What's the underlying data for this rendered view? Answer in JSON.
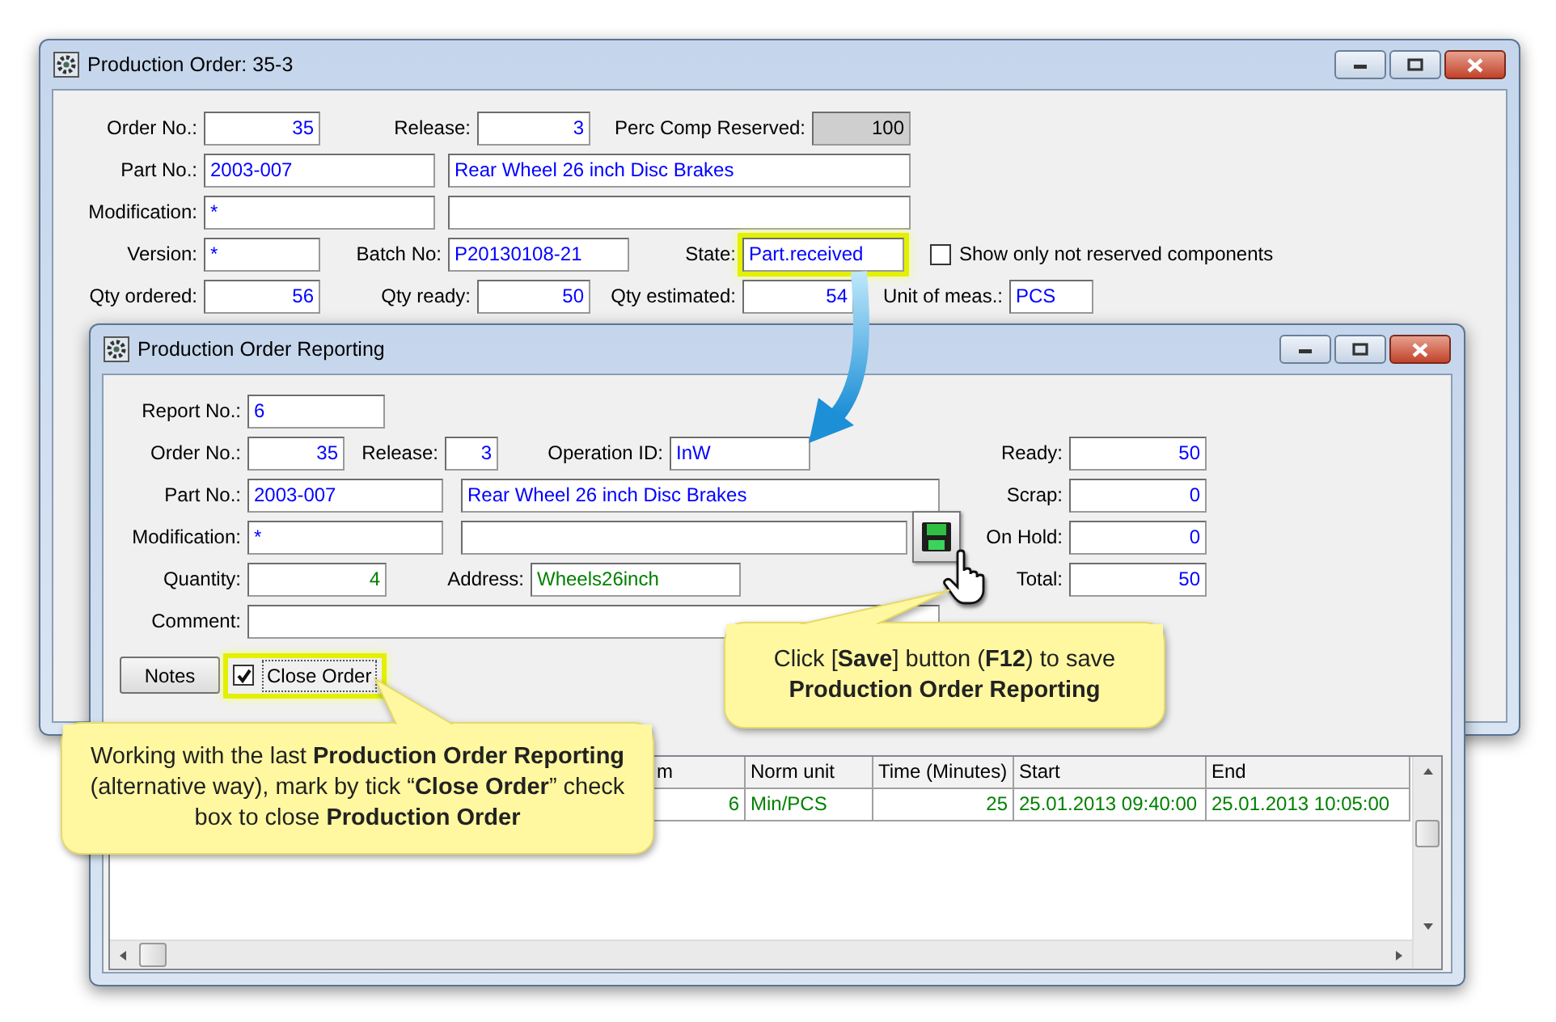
{
  "main_window": {
    "title": "Production Order: 35-3",
    "rows": [
      [
        {
          "label": "Order No.:",
          "value": "35",
          "kind": "number",
          "color": "#0000ff",
          "shaded": false,
          "highlighted": false
        },
        {
          "label": "Release:",
          "value": "3",
          "kind": "number",
          "color": "#0000ff",
          "shaded": false,
          "highlighted": false
        },
        {
          "label": "Perc Comp Reserved:",
          "value": "100",
          "kind": "number",
          "color": "#000000",
          "shaded": true,
          "highlighted": false
        }
      ],
      [
        {
          "label": "Part No.:",
          "value": "2003-007",
          "kind": "text",
          "color": "#0000ff",
          "shaded": false,
          "highlighted": false
        },
        {
          "value": "Rear Wheel 26 inch Disc Brakes",
          "kind": "text",
          "color": "#0000ff",
          "shaded": false,
          "highlighted": false
        }
      ],
      [
        {
          "label": "Modification:",
          "value": "*",
          "kind": "text",
          "color": "#0000ff",
          "shaded": false,
          "highlighted": false
        },
        {
          "kind": "text",
          "shaded": false,
          "highlighted": false
        }
      ],
      [
        {
          "label": "Version:",
          "value": "*",
          "kind": "text",
          "color": "#0000ff",
          "shaded": false,
          "highlighted": false
        },
        {
          "label": "Batch No:",
          "value": "P20130108-21",
          "kind": "text",
          "color": "#0000ff",
          "shaded": false,
          "highlighted": false
        },
        {
          "label": "State:",
          "value": "Part.received",
          "kind": "text",
          "color": "#0000ff",
          "shaded": false,
          "highlighted": true
        }
      ],
      [
        {
          "label": "Qty ordered:",
          "value": "56",
          "kind": "number",
          "color": "#0000ff",
          "shaded": false,
          "highlighted": false
        },
        {
          "label": "Qty ready:",
          "value": "50",
          "kind": "number",
          "color": "#0000ff",
          "shaded": false,
          "highlighted": false
        },
        {
          "label": "Qty estimated:",
          "value": "54",
          "kind": "number",
          "color": "#0000ff",
          "shaded": false,
          "highlighted": false
        },
        {
          "label": "Unit of meas.:",
          "value": "PCS",
          "kind": "text",
          "color": "#0000ff",
          "shaded": false,
          "highlighted": false
        }
      ]
    ],
    "checkbox": {
      "label": "Show only not reserved components",
      "checked": false
    }
  },
  "reporting_window": {
    "title": "Production Order Reporting",
    "rows": [
      [
        {
          "label": "Report No.:",
          "value": "6",
          "kind": "text",
          "color": "#0000ff"
        }
      ],
      [
        {
          "label": "Order No.:",
          "value": "35",
          "kind": "number",
          "color": "#0000ff"
        },
        {
          "label": "Release:",
          "value": "3",
          "kind": "number",
          "color": "#0000ff"
        },
        {
          "label": "Operation ID:",
          "value": "InW",
          "kind": "text",
          "color": "#0000ff"
        }
      ],
      [
        {
          "label": "Part No.:",
          "value": "2003-007",
          "kind": "text",
          "color": "#0000ff"
        },
        {
          "value": "Rear Wheel 26 inch Disc Brakes",
          "kind": "text",
          "color": "#0000ff"
        }
      ],
      [
        {
          "label": "Modification:",
          "value": "*",
          "kind": "text",
          "color": "#0000ff"
        },
        {
          "kind": "text"
        }
      ],
      [
        {
          "label": "Quantity:",
          "value": "4",
          "kind": "number",
          "color": "#008000"
        },
        {
          "label": "Address:",
          "value": "Wheels26inch",
          "kind": "text",
          "color": "#008000"
        }
      ],
      [
        {
          "label": "Comment:",
          "kind": "text"
        }
      ]
    ],
    "totals": [
      {
        "label": "Ready:",
        "value": "50"
      },
      {
        "label": "Scrap:",
        "value": "0"
      },
      {
        "label": "On Hold:",
        "value": "0"
      },
      {
        "label": "Total:",
        "value": "50"
      }
    ],
    "notes_button": "Notes",
    "close_order": {
      "label": "Close Order",
      "checked": true,
      "highlighted": true
    },
    "grid": {
      "columns": [
        "m",
        "Norm unit",
        "Time (Minutes)",
        "Start",
        "End"
      ],
      "rows": [
        {
          "cells": [
            "6",
            "Min/PCS",
            "25",
            "25.01.2013 09:40:00",
            "25.01.2013 10:05:00"
          ],
          "color": "#008000"
        }
      ]
    }
  },
  "callouts": [
    {
      "text": "Working with the last **Production Order Reporting** (alternative way), mark by tick “**Close Order**” check box to close **Production Order**"
    },
    {
      "text": "Click [**Save**] button (**F12**) to save **Production Order Reporting**"
    }
  ]
}
